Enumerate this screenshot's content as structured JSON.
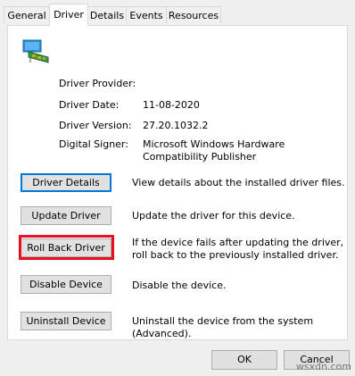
{
  "tabs": [
    {
      "label": "General"
    },
    {
      "label": "Driver"
    },
    {
      "label": "Details"
    },
    {
      "label": "Events"
    },
    {
      "label": "Resources"
    }
  ],
  "device_icon": "network-adapter-icon",
  "info": {
    "provider_label": "Driver Provider:",
    "provider_value": "",
    "date_label": "Driver Date:",
    "date_value": "11-08-2020",
    "version_label": "Driver Version:",
    "version_value": "27.20.1032.2",
    "signer_label": "Digital Signer:",
    "signer_value": "Microsoft Windows Hardware Compatibility Publisher"
  },
  "actions": [
    {
      "label": "Driver Details",
      "desc": "View details about the installed driver files."
    },
    {
      "label": "Update Driver",
      "desc": "Update the driver for this device."
    },
    {
      "label": "Roll Back Driver",
      "desc": "If the device fails after updating the driver, roll back to the previously installed driver."
    },
    {
      "label": "Disable Device",
      "desc": "Disable the device."
    },
    {
      "label": "Uninstall Device",
      "desc": "Uninstall the device from the system (Advanced)."
    }
  ],
  "footer": {
    "ok_label": "OK",
    "cancel_label": "Cancel"
  },
  "watermark": "wsxdn.com",
  "colors": {
    "highlight": "#e81123",
    "focus": "#0078d7"
  }
}
